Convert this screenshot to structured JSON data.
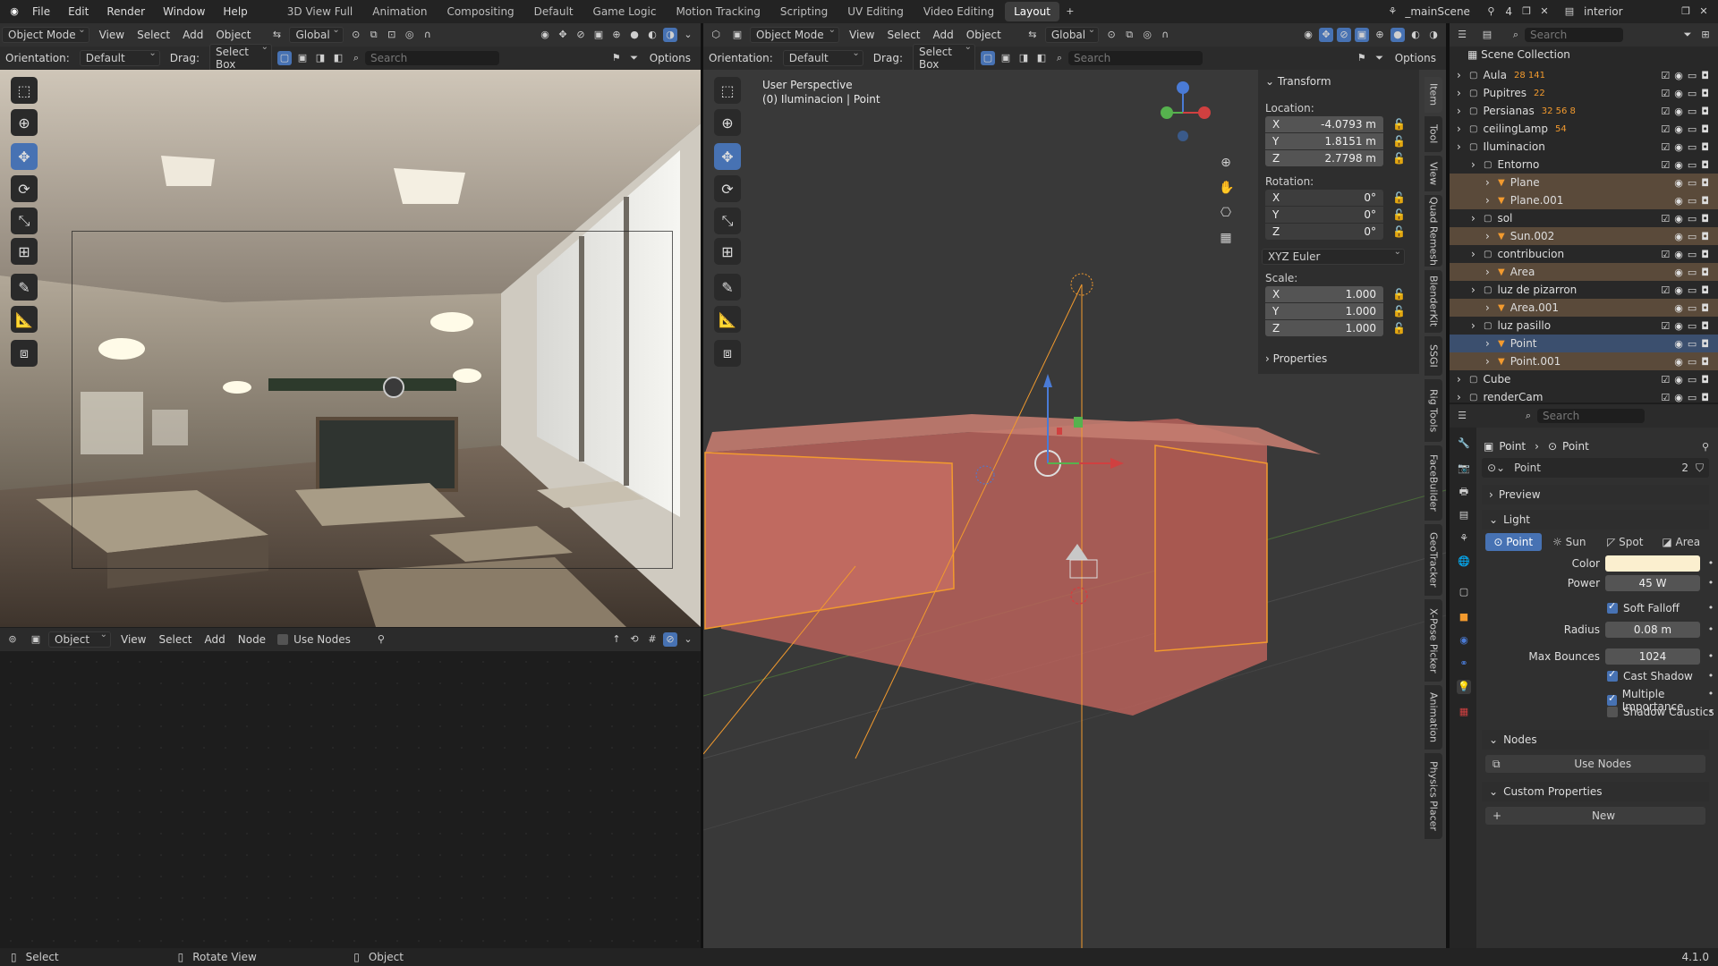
{
  "topbar": {
    "menus": [
      "File",
      "Edit",
      "Render",
      "Window",
      "Help"
    ],
    "workspaces": [
      "3D View Full",
      "Animation",
      "Compositing",
      "Default",
      "Game Logic",
      "Motion Tracking",
      "Scripting",
      "UV Editing",
      "Video Editing",
      "Layout"
    ],
    "active_workspace": "Layout",
    "scene_name": "_mainScene",
    "scene_users": "4",
    "view_layer": "interior"
  },
  "left_view": {
    "mode": "Object Mode",
    "menus": [
      "View",
      "Select",
      "Add",
      "Object"
    ],
    "transform": "Global",
    "orientation_label": "Orientation:",
    "orientation": "Default",
    "drag_label": "Drag:",
    "drag": "Select Box",
    "search_placeholder": "Search",
    "options": "Options"
  },
  "node_editor": {
    "type": "Object",
    "menus": [
      "View",
      "Select",
      "Add",
      "Node"
    ],
    "use_nodes": "Use Nodes"
  },
  "main_view": {
    "mode": "Object Mode",
    "menus": [
      "View",
      "Select",
      "Add",
      "Object"
    ],
    "transform": "Global",
    "orientation_label": "Orientation:",
    "orientation": "Default",
    "drag_label": "Drag:",
    "drag": "Select Box",
    "search_placeholder": "Search",
    "options": "Options",
    "overlay_title": "User Perspective",
    "overlay_sub": "(0) Iluminacion | Point"
  },
  "npanel": {
    "transform_title": "Transform",
    "location_label": "Location:",
    "location": [
      {
        "axis": "X",
        "value": "-4.0793 m"
      },
      {
        "axis": "Y",
        "value": "1.8151 m"
      },
      {
        "axis": "Z",
        "value": "2.7798 m"
      }
    ],
    "rotation_label": "Rotation:",
    "rotation": [
      {
        "axis": "X",
        "value": "0°"
      },
      {
        "axis": "Y",
        "value": "0°"
      },
      {
        "axis": "Z",
        "value": "0°"
      }
    ],
    "rotation_mode": "XYZ Euler",
    "scale_label": "Scale:",
    "scale": [
      {
        "axis": "X",
        "value": "1.000"
      },
      {
        "axis": "Y",
        "value": "1.000"
      },
      {
        "axis": "Z",
        "value": "1.000"
      }
    ],
    "properties_title": "Properties",
    "tabs": [
      "Item",
      "Tool",
      "View",
      "Quad Remesh",
      "BlenderKit",
      "SSGI",
      "Rig Tools",
      "FaceBuilder",
      "GeoTracker",
      "X-Pose Picker",
      "Animation",
      "Physics Placer"
    ]
  },
  "outliner": {
    "search_placeholder": "Search",
    "root": "Scene Collection",
    "rows": [
      {
        "label": "Aula",
        "badge": "28 141",
        "indent": 1
      },
      {
        "label": "Pupitres",
        "badge": "22",
        "indent": 1
      },
      {
        "label": "Persianas",
        "badge": "32 56 8",
        "indent": 1
      },
      {
        "label": "ceilingLamp",
        "badge": "54",
        "indent": 1
      },
      {
        "label": "Iluminacion",
        "badge": "",
        "indent": 1
      },
      {
        "label": "Entorno",
        "badge": "",
        "indent": 2
      },
      {
        "label": "Plane",
        "badge": "",
        "indent": 3
      },
      {
        "label": "Plane.001",
        "badge": "",
        "indent": 3
      },
      {
        "label": "sol",
        "badge": "",
        "indent": 2
      },
      {
        "label": "Sun.002",
        "badge": "",
        "indent": 3
      },
      {
        "label": "contribucion",
        "badge": "",
        "indent": 2
      },
      {
        "label": "Area",
        "badge": "",
        "indent": 3
      },
      {
        "label": "luz de pizarron",
        "badge": "",
        "indent": 2
      },
      {
        "label": "Area.001",
        "badge": "",
        "indent": 3
      },
      {
        "label": "luz pasillo",
        "badge": "",
        "indent": 2
      },
      {
        "label": "Point",
        "badge": "",
        "indent": 3
      },
      {
        "label": "Point.001",
        "badge": "",
        "indent": 3
      },
      {
        "label": "Cube",
        "badge": "",
        "indent": 1
      },
      {
        "label": "renderCam",
        "badge": "",
        "indent": 1
      }
    ]
  },
  "properties": {
    "search_placeholder": "Search",
    "breadcrumb_obj": "Point",
    "breadcrumb_data": "Point",
    "datablock": "Point",
    "datablock_users": "2",
    "preview": "Preview",
    "light": "Light",
    "light_types": [
      "Point",
      "Sun",
      "Spot",
      "Area"
    ],
    "active_type": "Point",
    "color_label": "Color",
    "color_value": "#fbefcf",
    "power_label": "Power",
    "power": "45 W",
    "soft_falloff": "Soft Falloff",
    "radius_label": "Radius",
    "radius": "0.08 m",
    "max_bounces_label": "Max Bounces",
    "max_bounces": "1024",
    "cast_shadow": "Cast Shadow",
    "multiple_importance": "Multiple Importance",
    "shadow_caustics": "Shadow Caustics",
    "nodes": "Nodes",
    "use_nodes": "Use Nodes",
    "custom_properties": "Custom Properties",
    "new": "New"
  },
  "status": {
    "select": "Select",
    "rotate": "Rotate View",
    "object": "Object",
    "version": "4.1.0"
  },
  "colors": {
    "accent": "#4772b3",
    "selected_obj": "#f29a2e",
    "room_fill": "#b8625a"
  }
}
